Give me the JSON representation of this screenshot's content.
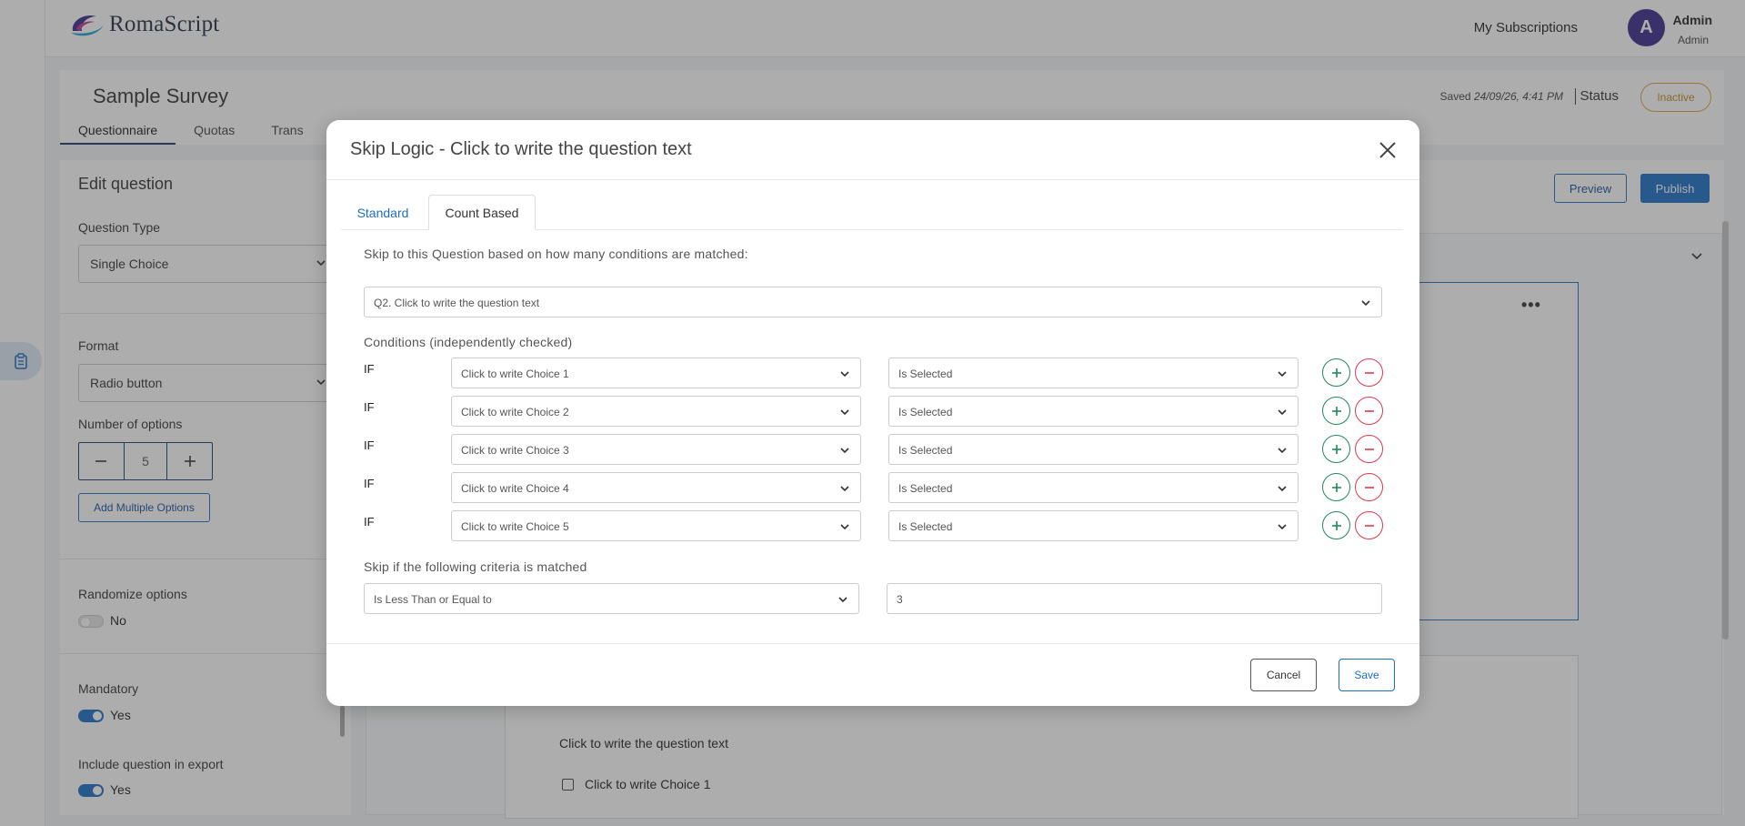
{
  "app": {
    "brand": "RomaScript"
  },
  "header": {
    "my_subscriptions": "My Subscriptions",
    "avatar_letter": "A",
    "user_name": "Admin",
    "user_role": "Admin"
  },
  "survey": {
    "title": "Sample Survey",
    "tabs": [
      "Questionnaire",
      "Quotas",
      "Trans"
    ],
    "saved_label": "Saved",
    "saved_time": "24/09/26, 4:41 PM",
    "status_label": "Status",
    "status_value": "Inactive"
  },
  "edit_panel": {
    "title": "Edit question",
    "question_type_label": "Question Type",
    "question_type_value": "Single Choice",
    "format_label": "Format",
    "format_value": "Radio button",
    "num_options_label": "Number of options",
    "num_options_value": "5",
    "add_multiple_label": "Add Multiple Options",
    "randomize_label": "Randomize options",
    "randomize_value": "No",
    "mandatory_label": "Mandatory",
    "mandatory_value": "Yes",
    "include_export_label": "Include question in export",
    "include_export_value": "Yes"
  },
  "toolbar": {
    "preview_label": "Preview",
    "publish_label": "Publish"
  },
  "background_question": {
    "question_text": "Click to write the question text",
    "choice_1": "Click to write Choice 1"
  },
  "modal": {
    "title": "Skip Logic - Click to write the question text",
    "tabs": {
      "standard": "Standard",
      "count_based": "Count Based"
    },
    "intro": "Skip to this Question based on how many conditions are matched:",
    "target_question": "Q2. Click to write the question text",
    "conditions_heading": "Conditions (independently checked)",
    "if_label": "IF",
    "conditions": [
      {
        "choice": "Click to write Choice 1",
        "operator": "Is Selected"
      },
      {
        "choice": "Click to write Choice 2",
        "operator": "Is Selected"
      },
      {
        "choice": "Click to write Choice 3",
        "operator": "Is Selected"
      },
      {
        "choice": "Click to write Choice 4",
        "operator": "Is Selected"
      },
      {
        "choice": "Click to write Choice 5",
        "operator": "Is Selected"
      }
    ],
    "criteria_heading": "Skip if the following criteria is matched",
    "criteria_operator": "Is Less Than or Equal to",
    "criteria_value": "3",
    "cancel_label": "Cancel",
    "save_label": "Save"
  },
  "colors": {
    "primary": "#1a6fc7",
    "add": "#1f8a5a",
    "remove": "#e0384a",
    "status_inactive": "#d9a441",
    "avatar": "#3b2a8c"
  }
}
